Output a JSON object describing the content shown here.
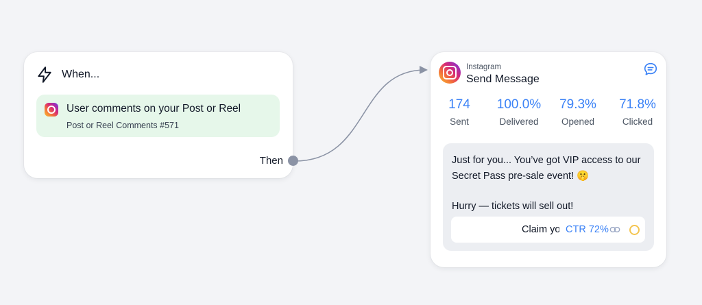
{
  "trigger": {
    "title": "When...",
    "item_title": "User comments on your Post or Reel",
    "item_subtitle": "Post or Reel Comments #571",
    "then_label": "Then"
  },
  "action": {
    "platform": "Instagram",
    "title": "Send Message",
    "stats": [
      {
        "value": "174",
        "label": "Sent"
      },
      {
        "value": "100.0%",
        "label": "Delivered"
      },
      {
        "value": "79.3%",
        "label": "Opened"
      },
      {
        "value": "71.8%",
        "label": "Clicked"
      }
    ],
    "message_line1": "Just for you... You’ve got VIP access to our Secret Pass pre-sale event! 🤫",
    "message_line2": "Hurry — tickets will sell out!",
    "button_label": "Claim your pass",
    "ctr": "CTR 72%"
  },
  "colors": {
    "accent": "#3b82f6",
    "trigger_bg": "#e6f7ea",
    "status_ring": "#f4c550"
  },
  "icons": [
    "lightning-icon",
    "instagram-icon",
    "chat-icon",
    "link-icon"
  ]
}
